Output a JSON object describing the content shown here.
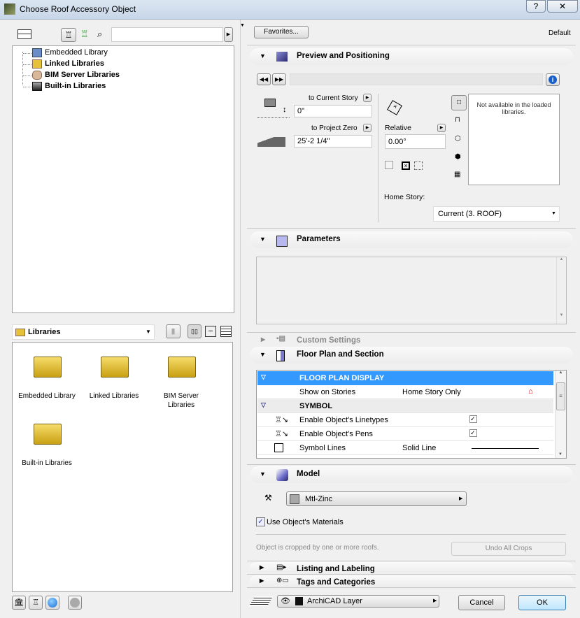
{
  "window": {
    "title": "Choose Roof Accessory Object",
    "help": "?",
    "close": "✕"
  },
  "left": {
    "tree": [
      {
        "label": "Embedded Library",
        "bold": false
      },
      {
        "label": "Linked Libraries",
        "bold": true
      },
      {
        "label": "BIM Server Libraries",
        "bold": true
      },
      {
        "label": "Built-in Libraries",
        "bold": true
      }
    ],
    "search_placeholder": "",
    "folder_select": "Libraries",
    "folders": [
      "Embedded Library",
      "Linked Libraries",
      "BIM Server Libraries",
      "Built-in Libraries"
    ]
  },
  "right": {
    "favorites": "Favorites...",
    "default_label": "Default",
    "preview": {
      "title": "Preview and Positioning",
      "to_current_story": "to Current Story",
      "current_story_value": "0\"",
      "to_project_zero": "to Project Zero",
      "project_zero_value": "25'-2 1/4\"",
      "relative": "Relative",
      "angle": "0.00°",
      "preview_msg": "Not available in the loaded libraries.",
      "home_story_label": "Home Story:",
      "home_story": "Current (3. ROOF)"
    },
    "parameters": {
      "title": "Parameters"
    },
    "custom": {
      "title": "Custom Settings"
    },
    "floorplan": {
      "title": "Floor Plan and Section",
      "rows": [
        {
          "type": "group",
          "label": "FLOOR PLAN DISPLAY",
          "selected": true
        },
        {
          "type": "item",
          "label": "Show on Stories",
          "value": "Home Story Only"
        },
        {
          "type": "group",
          "label": "SYMBOL"
        },
        {
          "type": "item",
          "label": "Enable Object's Linetypes",
          "checked": true
        },
        {
          "type": "item",
          "label": "Enable Object's Pens",
          "checked": true
        },
        {
          "type": "item",
          "label": "Symbol Lines",
          "value": "Solid Line"
        }
      ]
    },
    "model": {
      "title": "Model",
      "material": "Mtl-Zinc",
      "use_materials": "Use Object's Materials",
      "crop_msg": "Object is cropped by one or more roofs.",
      "undo_crops": "Undo All Crops"
    },
    "listing": {
      "title": "Listing and Labeling"
    },
    "tags": {
      "title": "Tags and Categories"
    },
    "layer": "ArchiCAD Layer",
    "cancel": "Cancel",
    "ok": "OK"
  },
  "colors": {
    "selection": "#3399ff",
    "accent": "#0a60c0"
  }
}
